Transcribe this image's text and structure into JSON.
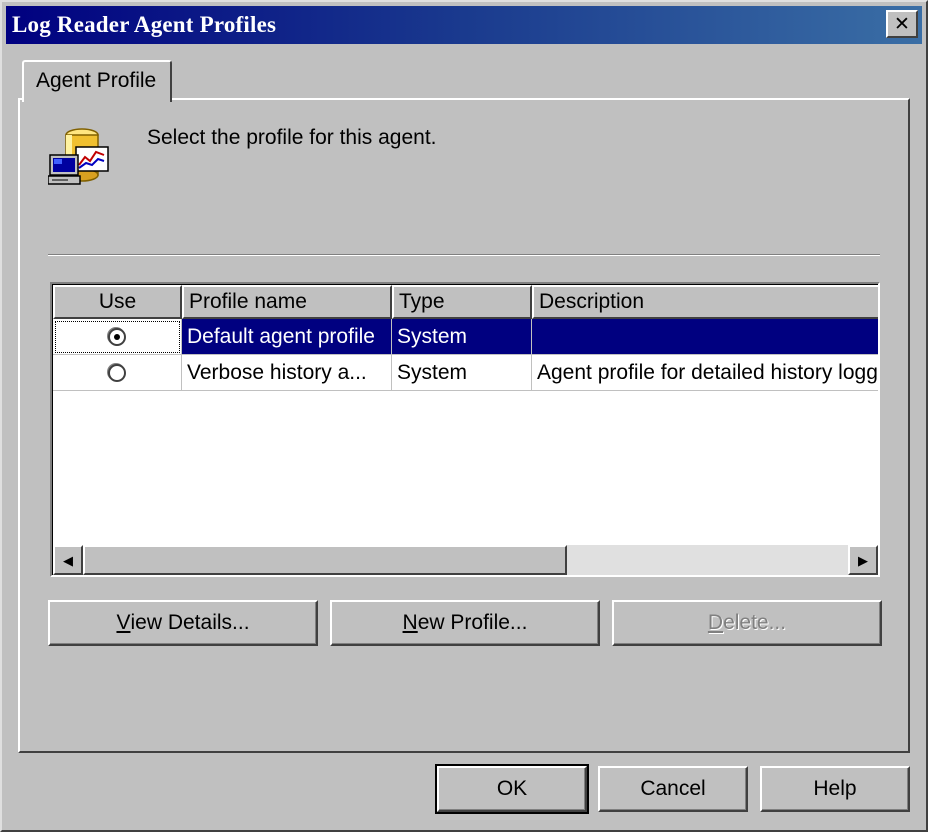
{
  "window": {
    "title": "Log Reader Agent Profiles",
    "close_glyph": "✕"
  },
  "tabs": [
    {
      "label": "Agent Profile",
      "active": true
    }
  ],
  "instruction": "Select the profile for this agent.",
  "icon": "database-computer-chart-icon",
  "profiles_table": {
    "columns": [
      "Use",
      "Profile name",
      "Type",
      "Description"
    ],
    "rows": [
      {
        "use": true,
        "name": "Default agent profile",
        "type": "System",
        "description": "",
        "selected": true
      },
      {
        "use": false,
        "name": "Verbose history a...",
        "type": "System",
        "description": "Agent profile for detailed history logg",
        "selected": false
      }
    ]
  },
  "buttons": {
    "view_details": {
      "accel": "V",
      "rest": "iew Details..."
    },
    "new_profile": {
      "accel": "N",
      "rest": "ew Profile..."
    },
    "delete": {
      "accel": "D",
      "rest": "elete...",
      "enabled": false
    },
    "ok": "OK",
    "cancel": "Cancel",
    "help": "Help"
  },
  "colors": {
    "title_bar": "#000080",
    "selection": "#000080",
    "face": "#c0c0c0"
  }
}
